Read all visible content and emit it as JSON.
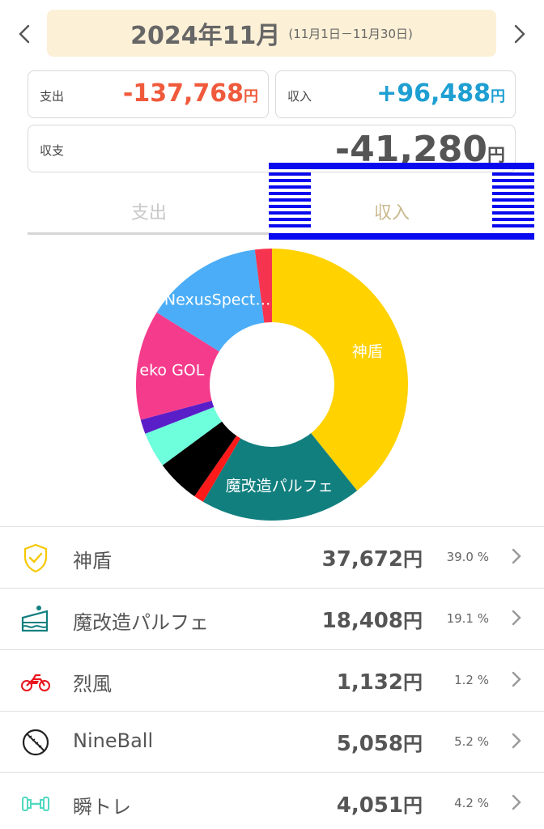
{
  "header": {
    "prev_icon": "chevron-left-icon",
    "next_icon": "chevron-right-icon",
    "title": "2024年11月",
    "range": "(11月1日－11月30日)"
  },
  "summary": {
    "expense_label": "支出",
    "expense_value": "-137,768",
    "income_label": "収入",
    "income_value": "+96,488",
    "balance_label": "収支",
    "balance_value": "-41,280",
    "unit": "円",
    "expense_color": "#f05a3c",
    "income_color": "#1e9fd2"
  },
  "tabs": [
    {
      "label": "支出",
      "active": false
    },
    {
      "label": "収入",
      "active": true
    }
  ],
  "chart_data": {
    "type": "pie",
    "donut": true,
    "slices": [
      {
        "label": "神盾",
        "value": 39.0,
        "color": "#ffd200"
      },
      {
        "label": "魔改造パルフェ",
        "value": 19.1,
        "color": "#127f7f"
      },
      {
        "label": "",
        "value": 1.2,
        "color": "#ff1a1a"
      },
      {
        "label": "",
        "value": 5.2,
        "color": "#000000"
      },
      {
        "label": "",
        "value": 4.2,
        "color": "#6effdc"
      },
      {
        "label": "",
        "value": 1.7,
        "color": "#5a1ec8"
      },
      {
        "label": "eko GOL",
        "value": 13.0,
        "color": "#f53c8c"
      },
      {
        "label": "NexusSpect…",
        "value": 14.0,
        "color": "#4badf7"
      },
      {
        "label": "",
        "value": 2.0,
        "color": "#f7344f"
      }
    ]
  },
  "list": [
    {
      "name": "神盾",
      "amount": "37,672",
      "pct": "39.0 %",
      "icon": "shield-check-icon",
      "color": "#ffd200"
    },
    {
      "name": "魔改造パルフェ",
      "amount": "18,408",
      "pct": "19.1 %",
      "icon": "cake-icon",
      "color": "#127f7f"
    },
    {
      "name": "烈風",
      "amount": "1,132",
      "pct": "1.2 %",
      "icon": "motorcycle-icon",
      "color": "#ff1a1a"
    },
    {
      "name": "NineBall",
      "amount": "5,058",
      "pct": "5.2 %",
      "icon": "baseball-icon",
      "color": "#000000"
    },
    {
      "name": "瞬トレ",
      "amount": "4,051",
      "pct": "4.2 %",
      "icon": "dumbbell-icon",
      "color": "#5fe3c8"
    }
  ]
}
